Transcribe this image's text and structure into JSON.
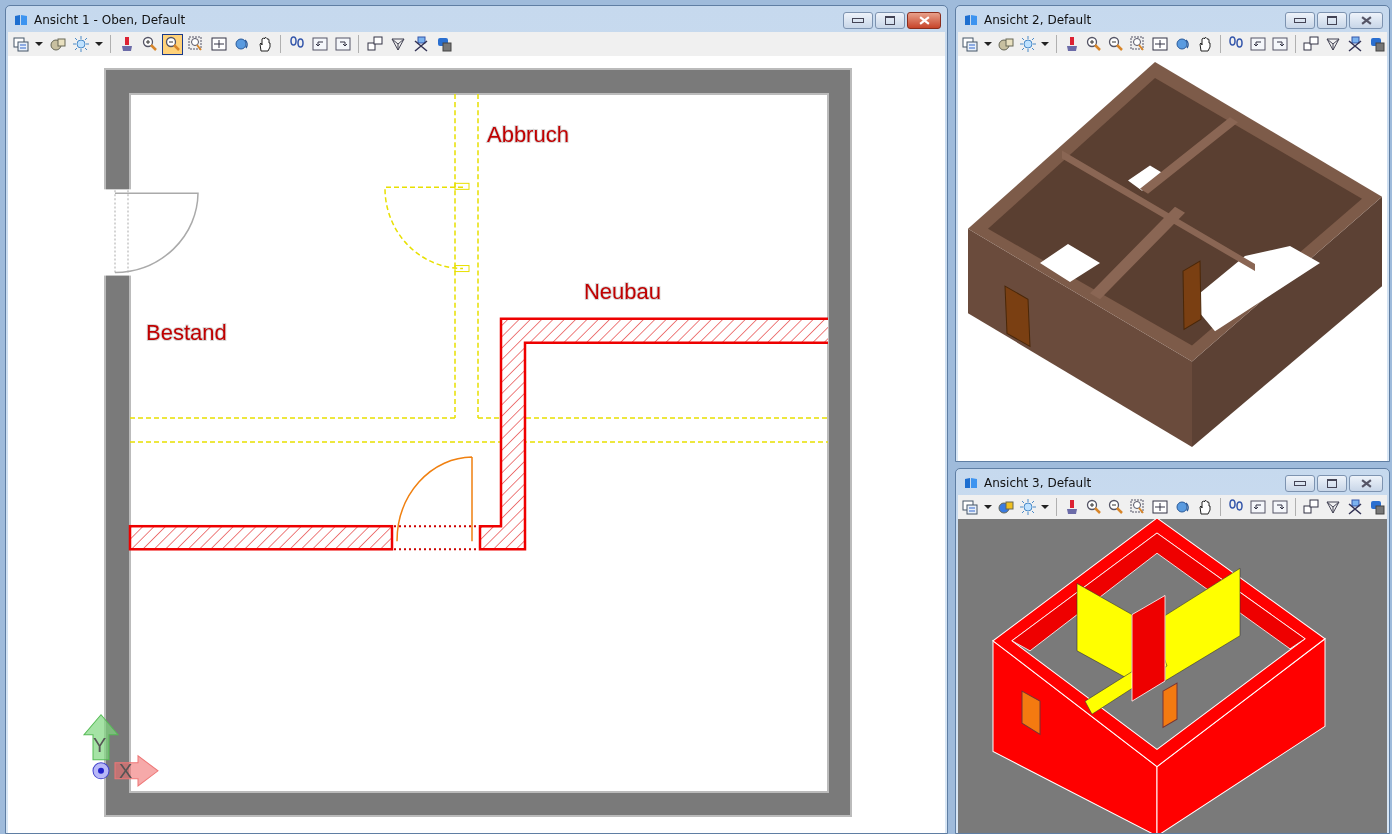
{
  "windows": [
    {
      "title": "Ansicht 1 - Oben, Default",
      "active": true,
      "kind": "plan",
      "toolbar": [
        {
          "tools": [
            {
              "kind": "view-attributes",
              "selected": false
            },
            {
              "kind": "dropdown",
              "selected": false
            },
            {
              "kind": "display-style",
              "selected": false
            },
            {
              "kind": "lighting",
              "selected": false
            },
            {
              "kind": "dropdown",
              "selected": false
            }
          ]
        },
        {
          "tools": [
            {
              "kind": "update",
              "selected": false
            },
            {
              "kind": "zoom-in",
              "selected": false
            },
            {
              "kind": "zoom-out",
              "selected": true
            },
            {
              "kind": "window-area",
              "selected": false
            },
            {
              "kind": "fit-view",
              "selected": false
            },
            {
              "kind": "rotate",
              "selected": false
            },
            {
              "kind": "pan",
              "selected": false
            }
          ]
        },
        {
          "tools": [
            {
              "kind": "walk",
              "selected": false
            },
            {
              "kind": "previous-view",
              "selected": false
            },
            {
              "kind": "next-view",
              "selected": false
            }
          ]
        },
        {
          "tools": [
            {
              "kind": "copy-view",
              "selected": false
            },
            {
              "kind": "clip-volume",
              "selected": false
            },
            {
              "kind": "clip-mask",
              "selected": false
            },
            {
              "kind": "camera",
              "selected": false
            }
          ]
        }
      ],
      "labels": [
        {
          "text": "Abbruch"
        },
        {
          "text": "Neubau"
        },
        {
          "text": "Bestand"
        }
      ],
      "axes": {
        "y": "Y",
        "x": "X"
      }
    },
    {
      "title": "Ansicht 2, Default",
      "active": false,
      "kind": "model-brown",
      "toolbar": [
        {
          "tools": [
            {
              "kind": "view-attributes",
              "selected": false
            },
            {
              "kind": "dropdown",
              "selected": false
            },
            {
              "kind": "display-style",
              "selected": false
            },
            {
              "kind": "lighting",
              "selected": false
            },
            {
              "kind": "dropdown",
              "selected": false
            }
          ]
        },
        {
          "tools": [
            {
              "kind": "update",
              "selected": false
            },
            {
              "kind": "zoom-in",
              "selected": false
            },
            {
              "kind": "zoom-out",
              "selected": false
            },
            {
              "kind": "window-area",
              "selected": false
            },
            {
              "kind": "fit-view",
              "selected": false
            },
            {
              "kind": "rotate",
              "selected": false
            },
            {
              "kind": "pan",
              "selected": false
            }
          ]
        },
        {
          "tools": [
            {
              "kind": "walk",
              "selected": false
            },
            {
              "kind": "previous-view",
              "selected": false
            },
            {
              "kind": "next-view",
              "selected": false
            }
          ]
        },
        {
          "tools": [
            {
              "kind": "copy-view",
              "selected": false
            },
            {
              "kind": "clip-volume",
              "selected": false
            },
            {
              "kind": "clip-mask",
              "selected": false
            },
            {
              "kind": "camera",
              "selected": false
            }
          ]
        }
      ]
    },
    {
      "title": "Ansicht 3, Default",
      "active": false,
      "kind": "model-red",
      "toolbar": [
        {
          "tools": [
            {
              "kind": "view-attributes",
              "selected": false
            },
            {
              "kind": "dropdown",
              "selected": false
            },
            {
              "kind": "display-style",
              "selected": false
            },
            {
              "kind": "lighting",
              "selected": false
            },
            {
              "kind": "dropdown",
              "selected": false
            }
          ]
        },
        {
          "tools": [
            {
              "kind": "update",
              "selected": false
            },
            {
              "kind": "zoom-in",
              "selected": false
            },
            {
              "kind": "zoom-out",
              "selected": false
            },
            {
              "kind": "window-area",
              "selected": false
            },
            {
              "kind": "fit-view",
              "selected": false
            },
            {
              "kind": "rotate",
              "selected": false
            },
            {
              "kind": "pan",
              "selected": false
            }
          ]
        },
        {
          "tools": [
            {
              "kind": "walk",
              "selected": false
            },
            {
              "kind": "previous-view",
              "selected": false
            },
            {
              "kind": "next-view",
              "selected": false
            }
          ]
        },
        {
          "tools": [
            {
              "kind": "copy-view",
              "selected": false
            },
            {
              "kind": "clip-volume",
              "selected": false
            },
            {
              "kind": "clip-mask",
              "selected": false
            },
            {
              "kind": "camera",
              "selected": false
            }
          ]
        }
      ]
    }
  ]
}
